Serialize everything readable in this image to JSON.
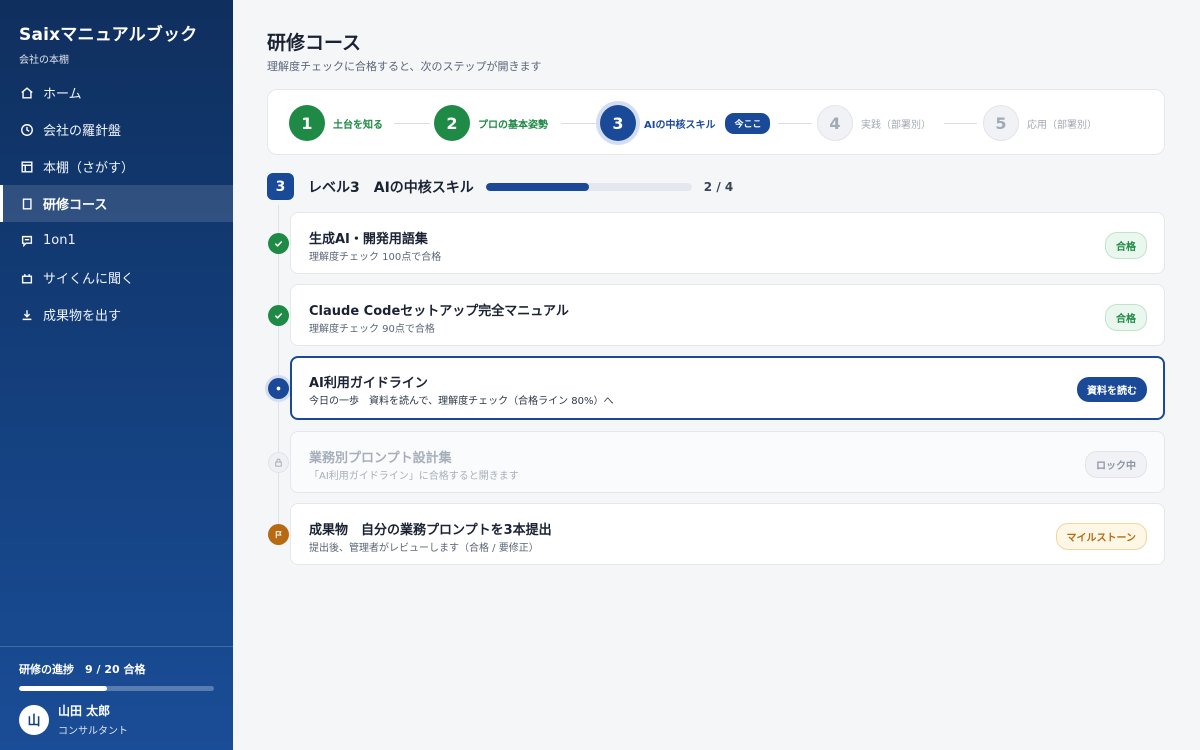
{
  "app": {
    "title": "Saixマニュアルブック",
    "subtitle": "会社の本棚"
  },
  "sidebar": {
    "items": [
      {
        "label": "ホーム",
        "icon": "home-icon"
      },
      {
        "label": "会社の羅針盤",
        "icon": "compass-icon"
      },
      {
        "label": "本棚（さがす）",
        "icon": "bookshelf-icon"
      },
      {
        "label": "研修コース",
        "icon": "book-icon",
        "active": true
      },
      {
        "label": "1on1",
        "icon": "chat-icon"
      },
      {
        "label": "サイくんに聞く",
        "icon": "bag-icon"
      },
      {
        "label": "成果物を出す",
        "icon": "download-icon"
      }
    ],
    "progress": {
      "label": "研修の進捗　9 / 20 合格",
      "value": 0.45
    },
    "user": {
      "initial": "山",
      "name": "山田 太郎",
      "role": "コンサルタント"
    }
  },
  "header": {
    "title": "研修コース",
    "subtitle": "理解度チェックに合格すると、次のステップが開きます"
  },
  "stepper": {
    "steps": [
      {
        "num": "1",
        "label": "土台を知る",
        "state": "done"
      },
      {
        "num": "2",
        "label": "プロの基本姿勢",
        "state": "done"
      },
      {
        "num": "3",
        "label": "AIの中核スキル",
        "state": "current",
        "badge": "今ここ"
      },
      {
        "num": "4",
        "label": "実践（部署別）",
        "state": "locked"
      },
      {
        "num": "5",
        "label": "応用（部署別）",
        "state": "locked"
      }
    ]
  },
  "level": {
    "num": "3",
    "title": "レベル3　AIの中核スキル",
    "progress": 0.5,
    "count": "2 / 4"
  },
  "items": [
    {
      "title": "生成AI・開発用語集",
      "sub": "理解度チェック 100点で合格",
      "status": "合格",
      "state": "done"
    },
    {
      "title": "Claude Codeセットアップ完全マニュアル",
      "sub": "理解度チェック 90点で合格",
      "status": "合格",
      "state": "done"
    },
    {
      "title": "AI利用ガイドライン",
      "sub": "今日の一歩　資料を読んで、理解度チェック（合格ライン 80%）へ",
      "status": "資料を読む",
      "state": "current"
    },
    {
      "title": "業務別プロンプト設計集",
      "sub": "「AI利用ガイドライン」に合格すると開きます",
      "status": "ロック中",
      "state": "locked"
    },
    {
      "title": "成果物　自分の業務プロンプトを3本提出",
      "sub": "提出後、管理者がレビューします（合格 / 要修正）",
      "status": "マイルストーン",
      "state": "milestone"
    }
  ],
  "colors": {
    "accent": "#1a4a97",
    "success": "#1e8a45",
    "milestone": "#b86a12",
    "sidebar": "#14407e"
  }
}
